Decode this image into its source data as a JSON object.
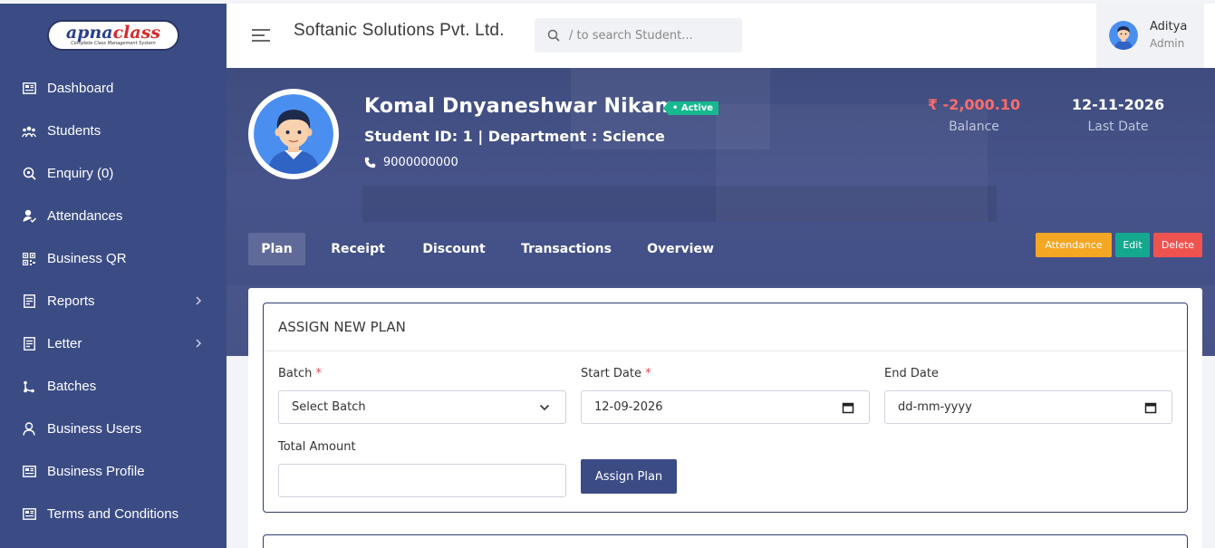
{
  "logo": {
    "main_a": "apna",
    "main_b": "class",
    "tagline": "Complete Class Management System"
  },
  "sidebar": {
    "items": [
      {
        "label": "Dashboard",
        "icon": "dashboard-icon",
        "has_arrow": false
      },
      {
        "label": "Students",
        "icon": "students-icon",
        "has_arrow": false
      },
      {
        "label": "Enquiry (0)",
        "icon": "enquiry-icon",
        "has_arrow": false
      },
      {
        "label": "Attendances",
        "icon": "attendance-icon",
        "has_arrow": false
      },
      {
        "label": "Business QR",
        "icon": "qr-icon",
        "has_arrow": false
      },
      {
        "label": "Reports",
        "icon": "reports-icon",
        "has_arrow": true
      },
      {
        "label": "Letter",
        "icon": "letter-icon",
        "has_arrow": true
      },
      {
        "label": "Batches",
        "icon": "batches-icon",
        "has_arrow": false
      },
      {
        "label": "Business Users",
        "icon": "user-icon",
        "has_arrow": false
      },
      {
        "label": "Business Profile",
        "icon": "profile-icon",
        "has_arrow": false
      },
      {
        "label": "Terms and Conditions",
        "icon": "terms-icon",
        "has_arrow": false
      }
    ]
  },
  "header": {
    "company": "Softanic Solutions Pvt. Ltd.",
    "search_placeholder": "/ to search Student...",
    "user_name": "Aditya",
    "user_role": "Admin"
  },
  "student": {
    "name": "Komal Dnyaneshwar Nikam",
    "status": "• Active",
    "info": "Student ID: 1  | Department : Science",
    "phone": "9000000000",
    "balance": "₹ -2,000.10",
    "balance_label": "Balance",
    "last_date": "12-11-2026",
    "last_date_label": "Last Date"
  },
  "tabs": [
    "Plan",
    "Receipt",
    "Discount",
    "Transactions",
    "Overview"
  ],
  "actions": {
    "attendance": "Attendance",
    "edit": "Edit",
    "delete": "Delete"
  },
  "form": {
    "title": "ASSIGN NEW PLAN",
    "batch_label": "Batch",
    "batch_value": "Select Batch",
    "start_label": "Start Date",
    "start_value": "12-09-2026",
    "end_label": "End Date",
    "end_value": "dd-mm-yyyy",
    "total_label": "Total Amount",
    "total_value": "",
    "required_mark": "*",
    "submit": "Assign Plan"
  },
  "colors": {
    "sidebar": "#3b4c85",
    "active_badge": "#17b890",
    "attendance_btn": "#f5a623",
    "edit_btn": "#14a88e",
    "delete_btn": "#ef5350",
    "balance": "#ff6b6b"
  }
}
